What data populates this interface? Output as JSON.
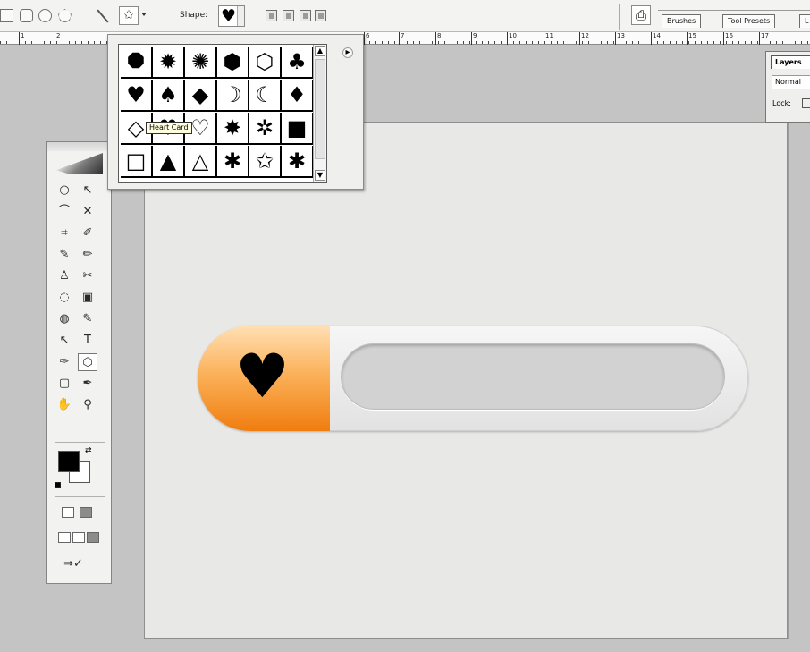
{
  "options_bar": {
    "shape_label": "Shape:",
    "selected_shape_icon": "heart-icon",
    "palette_well_tabs": [
      "Brushes",
      "Tool Presets",
      "L"
    ]
  },
  "ruler": {
    "numbers": [
      "1",
      "2",
      "6",
      "7",
      "8",
      "9",
      "10",
      "11",
      "12",
      "13",
      "14",
      "15",
      "16",
      "17"
    ]
  },
  "shape_picker_popup": {
    "shapes": [
      [
        "octagon-icon",
        "starburst-icon",
        "seal-icon",
        "hexagon-icon",
        "hexagon-outline-icon",
        "club-icon"
      ],
      [
        "heart-icon",
        "spade-icon",
        "diamond-icon",
        "crescent-icon",
        "crescent-outline-icon",
        "diamond-small-icon"
      ],
      [
        "diamond-outline-icon",
        "heart-card-icon",
        "heart-outline-icon",
        "burst-icon",
        "burst-outline-icon",
        "square-icon"
      ],
      [
        "square-outline-icon",
        "triangle-icon",
        "triangle-outline-icon",
        "puzzle-icon",
        "puzzle-outline-icon",
        "asterisk-icon"
      ]
    ],
    "glyphs": [
      [
        "⯃",
        "✹",
        "✺",
        "⬢",
        "⬡",
        "♣"
      ],
      [
        "♥",
        "♠",
        "◆",
        "☽",
        "☾",
        "♦"
      ],
      [
        "◇",
        "♥",
        "♡",
        "✸",
        "✲",
        "■"
      ],
      [
        "□",
        "▲",
        "△",
        "✱",
        "✩",
        "✱"
      ]
    ],
    "tooltip": "Heart Card"
  },
  "layers_panel": {
    "tab_label": "Layers",
    "blend_mode": "Normal",
    "lock_label": "Lock:"
  },
  "canvas": {
    "widget_icon": "heart-icon",
    "widget_glyph": "♥",
    "accent_color": "#f48a1f",
    "progress_fraction": 0.24
  },
  "tools": {
    "rows": [
      [
        "○",
        "↖"
      ],
      [
        "⌒",
        "✕"
      ],
      [
        "⌗",
        "✐"
      ],
      [
        "✎",
        "✏"
      ],
      [
        "♙",
        "✂"
      ],
      [
        "◌",
        "▣"
      ],
      [
        "◍",
        "✎"
      ],
      [
        "↖",
        "T"
      ],
      [
        "✑",
        "⬡"
      ],
      [
        "▢",
        "✒"
      ],
      [
        "✋",
        "⚲"
      ]
    ],
    "names": [
      [
        "marquee-tool-icon",
        "move-tool-icon"
      ],
      [
        "lasso-tool-icon",
        "magic-wand-tool-icon"
      ],
      [
        "crop-tool-icon",
        "slice-tool-icon"
      ],
      [
        "healing-brush-icon",
        "brush-tool-icon"
      ],
      [
        "clone-stamp-icon",
        "history-brush-icon"
      ],
      [
        "eraser-tool-icon",
        "gradient-tool-icon"
      ],
      [
        "blur-tool-icon",
        "dodge-tool-icon"
      ],
      [
        "path-selection-icon",
        "type-tool-icon"
      ],
      [
        "pen-tool-icon",
        "custom-shape-tool-icon"
      ],
      [
        "notes-tool-icon",
        "eyedropper-tool-icon"
      ],
      [
        "hand-tool-icon",
        "zoom-tool-icon"
      ]
    ],
    "foreground_color": "#000000",
    "background_color": "#ffffff"
  }
}
